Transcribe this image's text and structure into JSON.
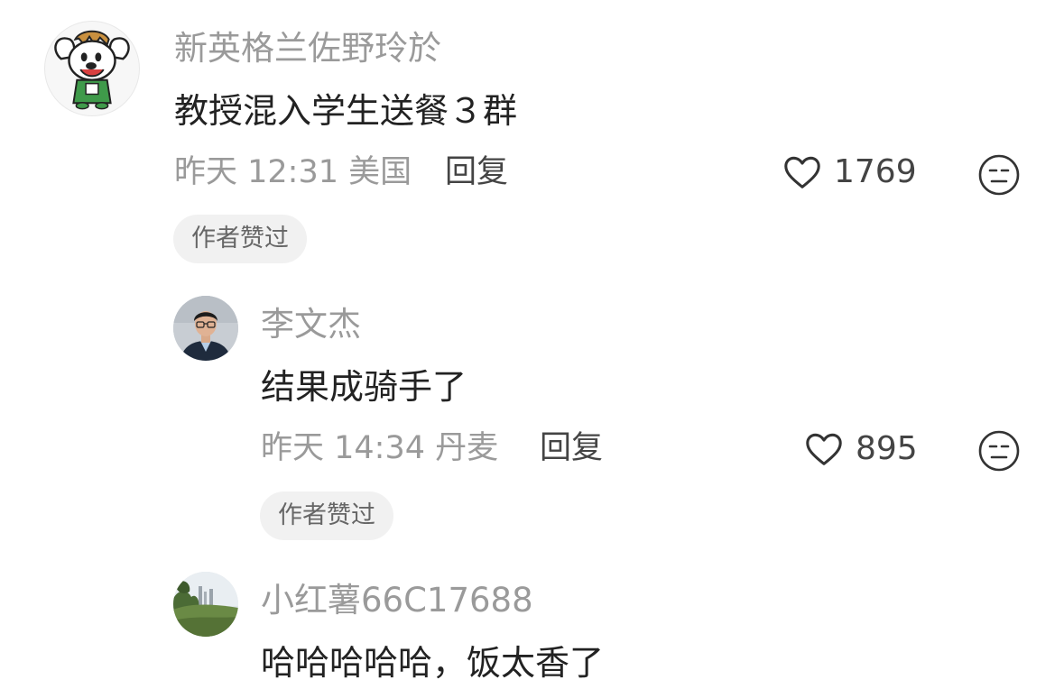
{
  "comments": [
    {
      "username": "新英格兰佐野玲於",
      "text": "教授混入学生送餐３群",
      "time": "昨天 12:31",
      "location": "美国",
      "reply_label": "回复",
      "likes": "1769",
      "badge": "作者赞过",
      "avatar_icon": "cartoon-dog-avatar-icon"
    },
    {
      "username": "李文杰",
      "text": "结果成骑手了",
      "time": "昨天 14:34",
      "location": "丹麦",
      "reply_label": "回复",
      "likes": "895",
      "badge": "作者赞过",
      "avatar_icon": "person-photo-avatar-icon"
    },
    {
      "username": "小红薯66C17688",
      "text": "哈哈哈哈哈，饭太香了",
      "avatar_icon": "landscape-photo-avatar-icon"
    }
  ],
  "colors": {
    "username": "#9a9a9a",
    "content": "#222222",
    "meta": "#9a9a9a",
    "badge_bg": "#f1f1f1"
  }
}
